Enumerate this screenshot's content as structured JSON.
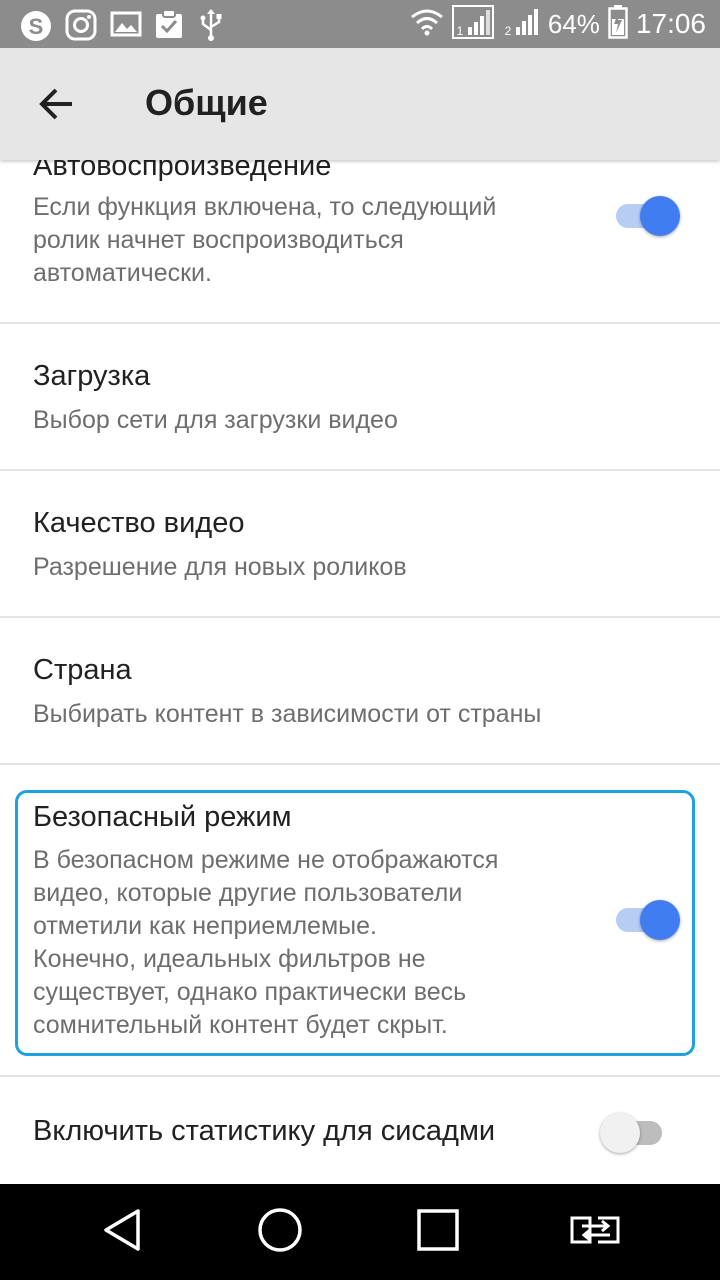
{
  "status_bar": {
    "battery": "64%",
    "time": "17:06",
    "sim1": "1",
    "sim2": "2",
    "icons": [
      "skype-icon",
      "instagram-icon",
      "gallery-icon",
      "clipboard-check-icon",
      "usb-icon",
      "wifi-icon",
      "signal-sim1-icon",
      "signal-sim2-icon",
      "battery-icon"
    ]
  },
  "app_bar": {
    "title": "Общие",
    "back_icon": "arrow-back-icon"
  },
  "settings": [
    {
      "id": "autoplay",
      "title": "Автовоспроизведение",
      "subtitle_lines": [
        "Если функция включена, то следующий",
        "ролик начнет воспроизводиться",
        "автоматически."
      ],
      "toggle": true
    },
    {
      "id": "download",
      "title": "Загрузка",
      "subtitle_lines": [
        "Выбор сети для загрузки видео"
      ]
    },
    {
      "id": "quality",
      "title": "Качество видео",
      "subtitle_lines": [
        "Разрешение для новых роликов"
      ]
    },
    {
      "id": "country",
      "title": "Страна",
      "subtitle_lines": [
        "Выбирать контент в зависимости от страны"
      ]
    },
    {
      "id": "safe-mode",
      "title": "Безопасный режим",
      "subtitle_lines": [
        "В безопасном режиме не отображаются",
        "видео, которые другие пользователи",
        "отметили как неприемлемые.",
        "Конечно, идеальных фильтров не",
        "существует, однако практически весь",
        "сомнительный контент будет скрыт."
      ],
      "toggle": true,
      "highlighted": true
    },
    {
      "id": "stats",
      "title": "Включить статистику для сисадми",
      "toggle": false
    }
  ],
  "nav_bar": {
    "icons": [
      "back-triangle-icon",
      "home-circle-icon",
      "recents-square-icon",
      "switch-sim-icon"
    ]
  },
  "colors": {
    "accent": "#3f7df0",
    "highlight_border": "#1ea1df",
    "status_bar": "#8c8c8c",
    "app_bar": "#e6e6e6"
  }
}
